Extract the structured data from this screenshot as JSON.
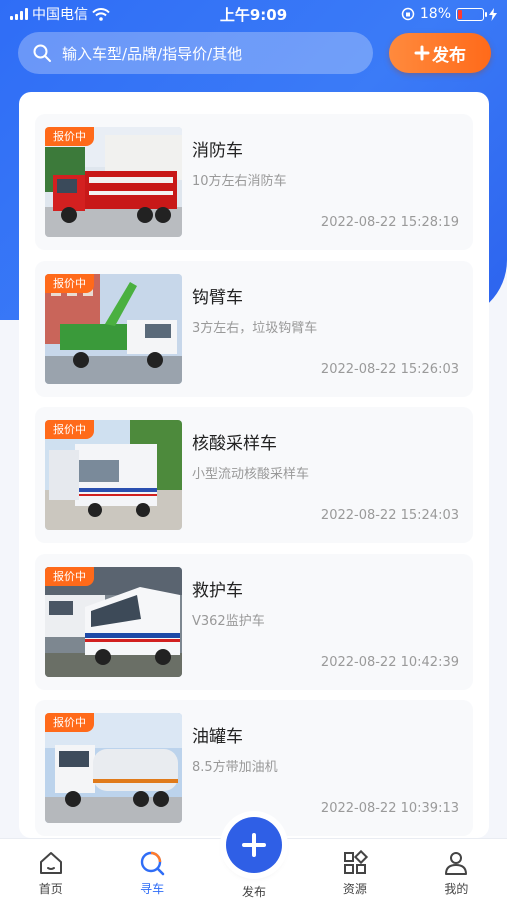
{
  "status_bar": {
    "carrier": "中国电信",
    "time": "上午9:09",
    "battery_percent": "18%",
    "battery_level": 0.18,
    "icons": [
      "signal-icon",
      "wifi-icon",
      "orientation-lock-icon",
      "battery-icon",
      "charging-icon"
    ]
  },
  "header": {
    "search_placeholder": "输入车型/品牌/指导价/其他",
    "publish_label": "发布",
    "accent_color": "#2f6df6",
    "publish_color": "#ff7a2a"
  },
  "listings": [
    {
      "tag": "报价中",
      "title": "消防车",
      "desc": "10方左右消防车",
      "time": "2022-08-22 15:28:19",
      "image": "fire-truck-photo"
    },
    {
      "tag": "报价中",
      "title": "钩臂车",
      "desc": "3方左右，垃圾钩臂车",
      "time": "2022-08-22 15:26:03",
      "image": "hook-arm-truck-photo"
    },
    {
      "tag": "报价中",
      "title": "核酸采样车",
      "desc": "小型流动核酸采样车",
      "time": "2022-08-22 15:24:03",
      "image": "sampling-vehicle-photo"
    },
    {
      "tag": "报价中",
      "title": "救护车",
      "desc": "V362监护车",
      "time": "2022-08-22 10:42:39",
      "image": "ambulance-photo"
    },
    {
      "tag": "报价中",
      "title": "油罐车",
      "desc": "8.5方带加油机",
      "time": "2022-08-22 10:39:13",
      "image": "tanker-truck-photo"
    }
  ],
  "tabbar": {
    "items": [
      {
        "label": "首页",
        "icon": "home-icon"
      },
      {
        "label": "寻车",
        "icon": "search-car-icon",
        "active": true
      },
      {
        "label": "发布",
        "icon": "plus-icon"
      },
      {
        "label": "资源",
        "icon": "grid-icon"
      },
      {
        "label": "我的",
        "icon": "user-icon"
      }
    ]
  }
}
